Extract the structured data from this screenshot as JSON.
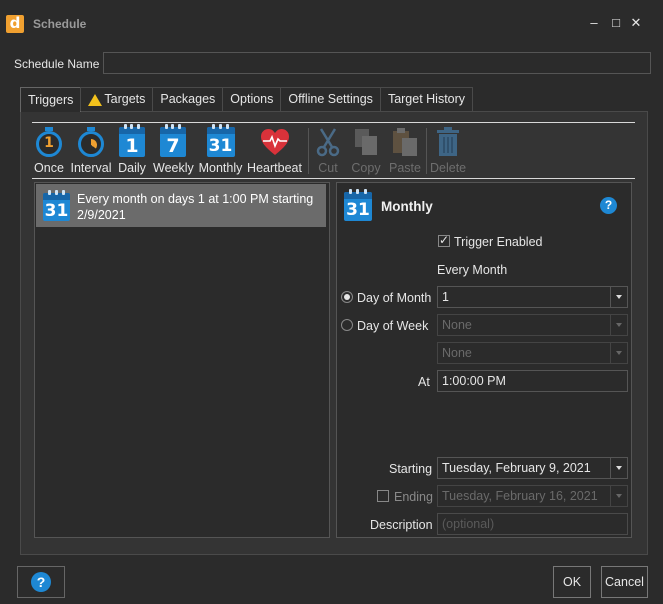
{
  "window": {
    "title": "Schedule",
    "logo_letter": "d",
    "minimize": "–",
    "maximize": "□",
    "close": "✕"
  },
  "schedule_name": {
    "label": "Schedule Name",
    "value": ""
  },
  "tabs": [
    {
      "label": "Triggers",
      "active": true
    },
    {
      "label": "Targets",
      "warning": true
    },
    {
      "label": "Packages"
    },
    {
      "label": "Options"
    },
    {
      "label": "Offline Settings"
    },
    {
      "label": "Target History"
    }
  ],
  "toolbar": {
    "once": "Once",
    "interval": "Interval",
    "daily": "Daily",
    "weekly": "Weekly",
    "monthly": "Monthly",
    "heartbeat": "Heartbeat",
    "cut": "Cut",
    "copy": "Copy",
    "paste": "Paste",
    "delete": "Delete",
    "icon_numbers": {
      "once": "1",
      "daily": "1",
      "weekly": "7",
      "monthly": "31"
    }
  },
  "trigger_list": [
    {
      "text": "Every month on days 1 at 1:00 PM starting 2/9/2021",
      "icon_number": "31"
    }
  ],
  "detail": {
    "title": "Monthly",
    "icon_number": "31",
    "help": "?",
    "trigger_enabled_label": "Trigger Enabled",
    "trigger_enabled": true,
    "every_month_label": "Every Month",
    "day_of_month_label": "Day of Month",
    "day_of_month_value": "1",
    "day_of_week_label": "Day of Week",
    "day_of_week_value": "None",
    "day_of_week_value2": "None",
    "at_label": "At",
    "at_value": "1:00:00 PM",
    "starting_label": "Starting",
    "starting_value": "Tuesday, February 9, 2021",
    "ending_label": "Ending",
    "ending_value": "Tuesday, February 16, 2021",
    "ending_enabled": false,
    "description_label": "Description",
    "description_placeholder": "(optional)"
  },
  "buttons": {
    "help": "?",
    "ok": "OK",
    "cancel": "Cancel"
  },
  "colors": {
    "accent": "#1e88d4",
    "logo": "#f0a030",
    "warning": "#f3c21c",
    "heartbeat": "#d9323a"
  }
}
